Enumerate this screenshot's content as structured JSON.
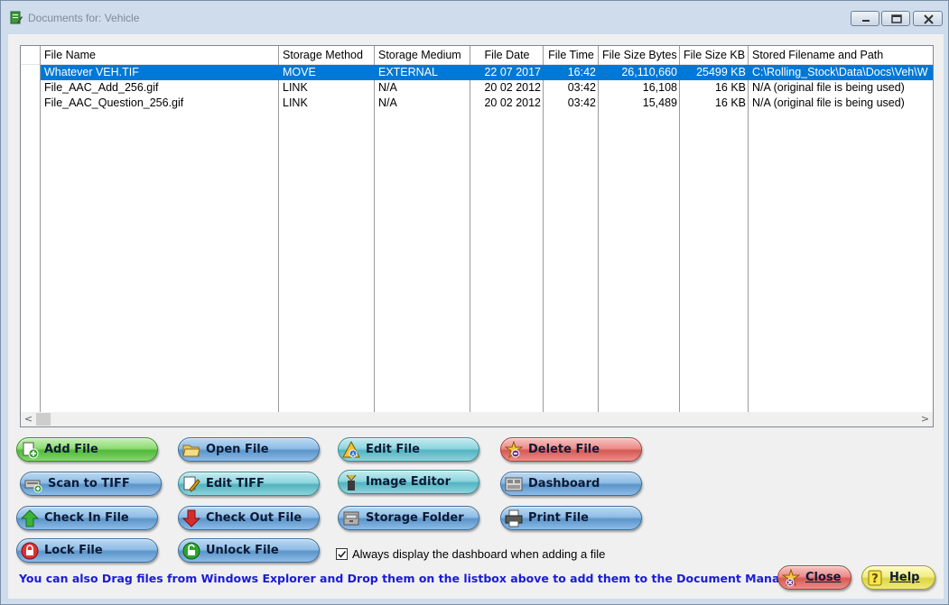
{
  "window": {
    "title": "Documents for: Vehicle"
  },
  "table": {
    "columns": [
      "File Name",
      "Storage Method",
      "Storage Medium",
      "File Date",
      "File Time",
      "File Size Bytes",
      "File Size KB",
      "Stored Filename and Path"
    ],
    "rows": [
      [
        "Whatever VEH.TIF",
        "MOVE",
        "EXTERNAL",
        "22 07 2017",
        "16:42",
        "26,110,660",
        "25499 KB",
        "C:\\Rolling_Stock\\Data\\Docs\\Veh\\W"
      ],
      [
        "File_AAC_Add_256.gif",
        "LINK",
        "N/A",
        "20 02 2012",
        "03:42",
        "16,108",
        "16 KB",
        "N/A (original file is being used)"
      ],
      [
        "File_AAC_Question_256.gif",
        "LINK",
        "N/A",
        "20 02 2012",
        "03:42",
        "15,489",
        "16 KB",
        "N/A (original file is being used)"
      ]
    ],
    "selected_row": 0
  },
  "buttons": {
    "add_file": "Add File",
    "scan_to_tiff": "Scan to TIFF",
    "check_in_file": "Check In File",
    "lock_file": "Lock File",
    "open_file": "Open File",
    "edit_tiff": "Edit TIFF",
    "check_out_file": "Check Out File",
    "unlock_file": "Unlock File",
    "edit_file": "Edit File",
    "image_editor": "Image Editor",
    "storage_folder": "Storage Folder",
    "delete_file": "Delete File",
    "dashboard": "Dashboard",
    "print_file": "Print File",
    "close": "Close",
    "help": "Help"
  },
  "options": {
    "always_display_dashboard": "Always display the dashboard when adding a file",
    "always_display_dashboard_checked": true
  },
  "hint": "You can also Drag files from Windows Explorer and Drop them on the listbox above to add them to the Document Manager",
  "colors": {
    "selection": "#0078d7",
    "hint_text": "#1a1adc"
  }
}
